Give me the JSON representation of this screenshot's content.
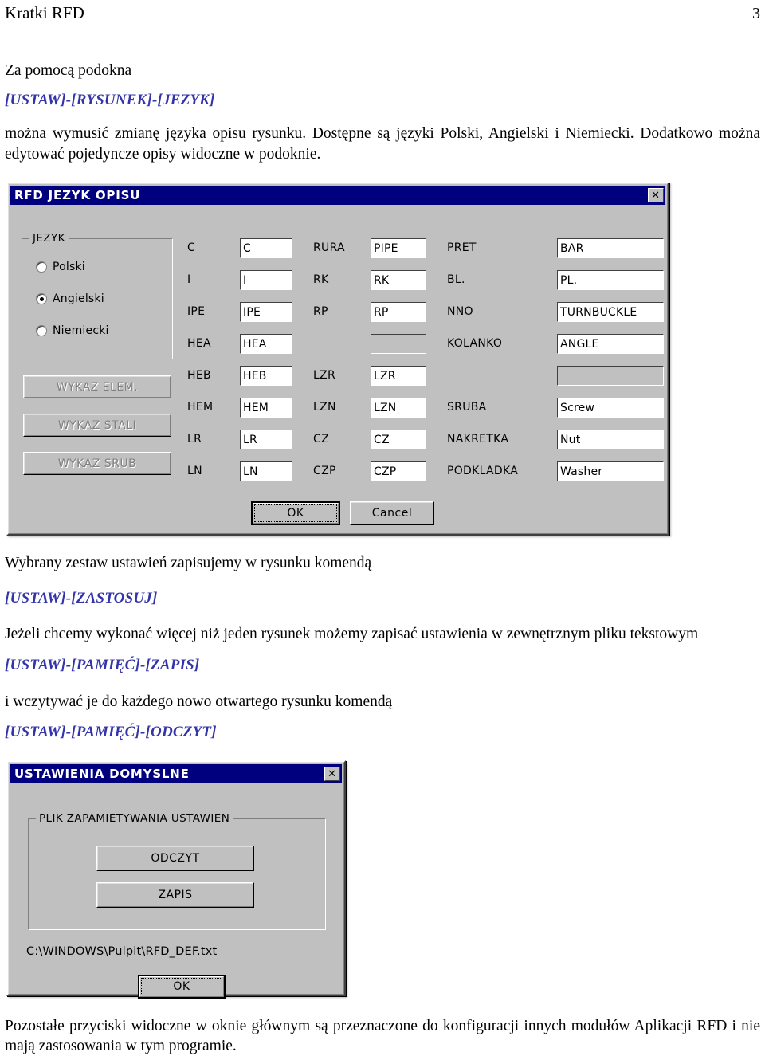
{
  "header": {
    "title": "Kratki RFD",
    "page": "3"
  },
  "body": {
    "p1": "Za pomocą podokna",
    "cmd1": "[USTAW]-[RYSUNEK]-[JEZYK]",
    "p2": "można wymusić zmianę języka opisu rysunku. Dostępne są  języki Polski, Angielski i Niemiecki. Dodatkowo można edytować pojedyncze opisy widoczne w podoknie.",
    "p3": "Wybrany zestaw ustawień zapisujemy w rysunku komendą",
    "cmd2": "[USTAW]-[ZASTOSUJ]",
    "p4": "Jeżeli chcemy wykonać więcej niż jeden rysunek możemy zapisać ustawienia w zewnętrznym pliku tekstowym",
    "cmd3": "[USTAW]-[PAMIĘĆ]-[ZAPIS]",
    "p5": "i wczytywać je do każdego nowo otwartego rysunku komendą",
    "cmd4": "[USTAW]-[PAMIĘĆ]-[ODCZYT]",
    "p6": "Pozostałe przyciski widoczne w oknie głównym są przeznaczone do konfiguracji innych modułów Aplikacji RFD i nie mają zastosowania w tym programie."
  },
  "dialog1": {
    "title": "RFD JEZYK OPISU",
    "close_label": "✕",
    "language_group": {
      "title": "JEZYK",
      "options": [
        {
          "label": "Polski",
          "selected": false
        },
        {
          "label": "Angielski",
          "selected": true
        },
        {
          "label": "Niemiecki",
          "selected": false
        }
      ]
    },
    "side_buttons": [
      {
        "label": "WYKAZ ELEM.",
        "disabled": true
      },
      {
        "label": "WYKAZ STALI",
        "disabled": true
      },
      {
        "label": "WYKAZ SRUB",
        "disabled": true
      }
    ],
    "col1": [
      {
        "label": "C",
        "value": "C"
      },
      {
        "label": "I",
        "value": "I"
      },
      {
        "label": "IPE",
        "value": "IPE"
      },
      {
        "label": "HEA",
        "value": "HEA"
      },
      {
        "label": "HEB",
        "value": "HEB"
      },
      {
        "label": "HEM",
        "value": "HEM"
      },
      {
        "label": "LR",
        "value": "LR"
      },
      {
        "label": "LN",
        "value": "LN"
      }
    ],
    "col2": [
      {
        "label": "RURA",
        "value": "PIPE"
      },
      {
        "label": "RK",
        "value": "RK"
      },
      {
        "label": "RP",
        "value": "RP"
      },
      {
        "label": "",
        "value": ""
      },
      {
        "label": "LZR",
        "value": "LZR"
      },
      {
        "label": "LZN",
        "value": "LZN"
      },
      {
        "label": "CZ",
        "value": "CZ"
      },
      {
        "label": "CZP",
        "value": "CZP"
      }
    ],
    "col3": [
      {
        "label": "PRET",
        "value": "BAR"
      },
      {
        "label": "BL.",
        "value": "PL."
      },
      {
        "label": "NNO",
        "value": "TURNBUCKLE"
      },
      {
        "label": "KOLANKO",
        "value": "ANGLE"
      },
      {
        "label": "",
        "value": ""
      },
      {
        "label": "SRUBA",
        "value": "Screw"
      },
      {
        "label": "NAKRETKA",
        "value": "Nut"
      },
      {
        "label": "PODKLADKA",
        "value": "Washer"
      }
    ],
    "ok_label": "OK",
    "cancel_label": "Cancel"
  },
  "dialog2": {
    "title": "USTAWIENIA DOMYSLNE",
    "close_label": "✕",
    "group_title": "PLIK ZAPAMIETYWANIA USTAWIEN",
    "read_label": "ODCZYT",
    "write_label": "ZAPIS",
    "path": "C:\\WINDOWS\\Pulpit\\RFD_DEF.txt",
    "ok_label": "OK"
  },
  "colors": {
    "titlebar": "#00007f",
    "face": "#c0c0c0",
    "link": "#3333aa"
  }
}
